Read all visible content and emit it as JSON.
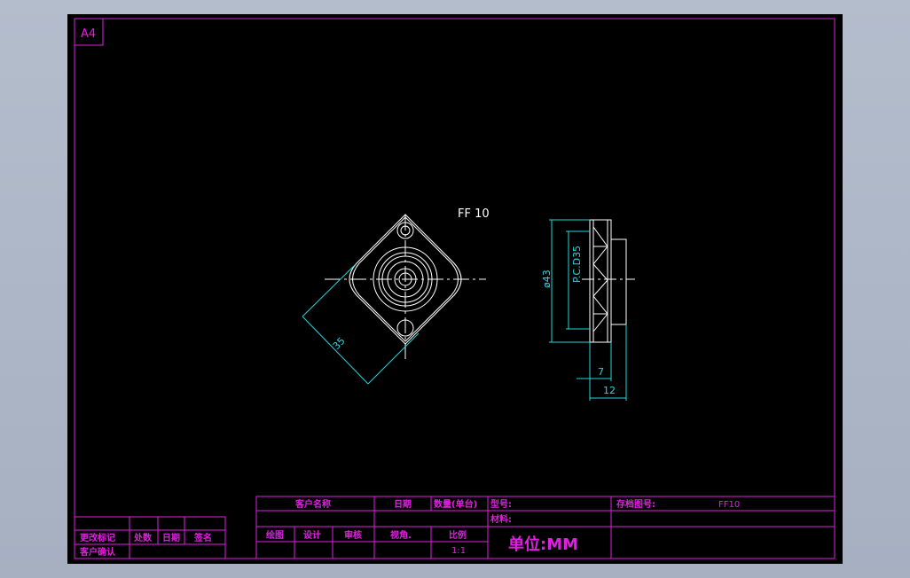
{
  "sheet": {
    "size_label": "A4"
  },
  "drawing": {
    "part_title": "FF 10",
    "dim_diagonal": "35",
    "dim_outer_dia": "ø43",
    "dim_pcd": "P.C.D35",
    "dim_small_width": "7",
    "dim_total_width": "12"
  },
  "title_block": {
    "change_mark": "更改标记",
    "count": "处数",
    "date_left": "日期",
    "signature": "签名",
    "customer_confirm": "客户确认",
    "customer_name": "客户名称",
    "date": "日期",
    "quantity": "数量(单台)",
    "model_label": "型号:",
    "drawing_no_label": "存档图号:",
    "drawing_no_value": "FF10",
    "material_label": "材料:",
    "drawn": "绘图",
    "design": "设计",
    "review": "审核",
    "view_angle": "视角.",
    "scale_label": "比例",
    "scale_value": "1:1",
    "unit": "单位:MM"
  },
  "colors": {
    "background": "#000000",
    "frame": "#e020e0",
    "geometry": "#ffffff",
    "dimensions": "#22d8e0",
    "title_text": "#e020e0"
  }
}
